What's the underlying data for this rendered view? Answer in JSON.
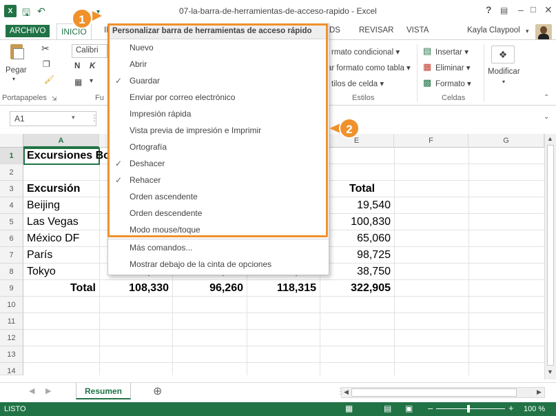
{
  "window": {
    "title": "07-la-barra-de-herramientas-de-acceso-rapido - Excel",
    "help": "?",
    "user": "Kayla Claypool"
  },
  "tabs": [
    "ARCHIVO",
    "INICIO",
    "IN",
    "DS",
    "REVISAR",
    "VISTA"
  ],
  "ribbon": {
    "paste_label": "Pegar",
    "font_name": "Calibri",
    "bold": "N",
    "italic": "K",
    "cond_format": "rmato condicional",
    "table_format": "ar formato como tabla",
    "cell_styles": "tilos de celda",
    "insert": "Insertar",
    "delete": "Eliminar",
    "format": "Formato",
    "modify": "Modificar",
    "groups": {
      "clipboard": "Portapapeles",
      "font": "Fu",
      "styles": "Estilos",
      "cells": "Celdas"
    }
  },
  "formula_bar": {
    "name_box": "A1"
  },
  "columns": [
    "A",
    "",
    "",
    "",
    "E",
    "F",
    "G"
  ],
  "rows": [
    "1",
    "2",
    "3",
    "4",
    "5",
    "6",
    "7",
    "8",
    "9",
    "10",
    "11",
    "12",
    "13",
    "14"
  ],
  "cells": {
    "a1": "Excursiones Bo",
    "a3": "Excursión",
    "a4": "Beijing",
    "a5": "Las Vegas",
    "a6": "México DF",
    "a7": "París",
    "a8": "Tokyo",
    "a9": "Total",
    "e3": "Total",
    "e4": "19,540",
    "e5": "100,830",
    "e6": "65,060",
    "e7": "98,725",
    "e8": "38,750",
    "b8": "12,510",
    "c8": "14,750",
    "d8": "11,490",
    "b9": "108,330",
    "c9": "96,260",
    "d9": "118,315",
    "e9": "322,905"
  },
  "sheet_tab": "Resumen",
  "status": {
    "ready": "LISTO",
    "zoom": "100 %"
  },
  "menu": {
    "header": "Personalizar barra de herramientas de acceso rápido",
    "items": [
      {
        "label": "Nuevo",
        "checked": false
      },
      {
        "label": "Abrir",
        "checked": false
      },
      {
        "label": "Guardar",
        "checked": true
      },
      {
        "label": "Enviar por correo electrónico",
        "checked": false
      },
      {
        "label": "Impresión rápida",
        "checked": false
      },
      {
        "label": "Vista previa de impresión e Imprimir",
        "checked": false
      },
      {
        "label": "Ortografía",
        "checked": false
      },
      {
        "label": "Deshacer",
        "checked": true
      },
      {
        "label": "Rehacer",
        "checked": true
      },
      {
        "label": "Orden ascendente",
        "checked": false
      },
      {
        "label": "Orden descendente",
        "checked": false
      },
      {
        "label": "Modo mouse/toque",
        "checked": false
      }
    ],
    "more_commands": "Más comandos...",
    "show_below": "Mostrar debajo de la cinta de opciones"
  },
  "callouts": [
    "1",
    "2"
  ],
  "accent_color": "#217346",
  "highlight_color": "#f0912c"
}
